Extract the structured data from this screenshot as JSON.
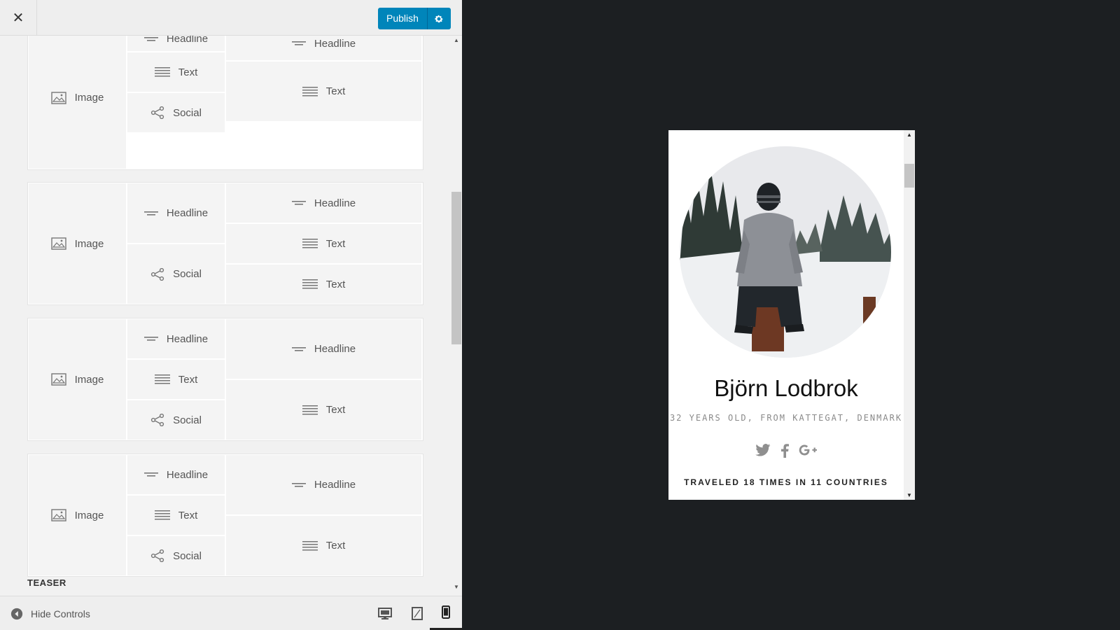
{
  "header": {
    "close_label": "✕",
    "publish_label": "Publish"
  },
  "layouts": [
    {
      "left": {
        "label": "Image",
        "icon": "image-icon"
      },
      "middle": [
        {
          "label": "Headline",
          "icon": "headline-icon"
        },
        {
          "label": "Text",
          "icon": "text-icon"
        },
        {
          "label": "Social",
          "icon": "share-icon"
        }
      ],
      "right": [
        {
          "label": "Headline",
          "icon": "headline-icon"
        },
        {
          "label": "Text",
          "icon": "text-icon"
        }
      ]
    },
    {
      "left": {
        "label": "Image",
        "icon": "image-icon"
      },
      "middle": [
        {
          "label": "Headline",
          "icon": "headline-icon"
        },
        {
          "label": "Social",
          "icon": "share-icon"
        }
      ],
      "right": [
        {
          "label": "Headline",
          "icon": "headline-icon"
        },
        {
          "label": "Text",
          "icon": "text-icon"
        },
        {
          "label": "Text",
          "icon": "text-icon"
        }
      ]
    },
    {
      "left": {
        "label": "Image",
        "icon": "image-icon"
      },
      "middle": [
        {
          "label": "Headline",
          "icon": "headline-icon"
        },
        {
          "label": "Text",
          "icon": "text-icon"
        },
        {
          "label": "Social",
          "icon": "share-icon"
        }
      ],
      "right": [
        {
          "label": "Headline",
          "icon": "headline-icon"
        },
        {
          "label": "Text",
          "icon": "text-icon"
        }
      ]
    },
    {
      "left": {
        "label": "Image",
        "icon": "image-icon"
      },
      "middle": [
        {
          "label": "Headline",
          "icon": "headline-icon"
        },
        {
          "label": "Text",
          "icon": "text-icon"
        },
        {
          "label": "Social",
          "icon": "share-icon"
        }
      ],
      "right": [
        {
          "label": "Headline",
          "icon": "headline-icon"
        },
        {
          "label": "Text",
          "icon": "text-icon"
        }
      ]
    }
  ],
  "teaser_heading": "TEASER",
  "footer": {
    "hide_controls_label": "Hide Controls",
    "devices": [
      "desktop",
      "tablet",
      "mobile"
    ],
    "active_device": "mobile"
  },
  "preview": {
    "name": "Björn Lodbrok",
    "subtitle": "32 YEARS OLD, FROM KATTEGAT, DENMARK",
    "social_icons": [
      "twitter-icon",
      "facebook-icon",
      "google-plus-icon"
    ],
    "stat": "TRAVELED 18 TIMES IN 11 COUNTRIES"
  },
  "colors": {
    "accent": "#0085ba",
    "preview_backdrop": "#1c1f22",
    "panel_bg": "#f1f1f1"
  }
}
